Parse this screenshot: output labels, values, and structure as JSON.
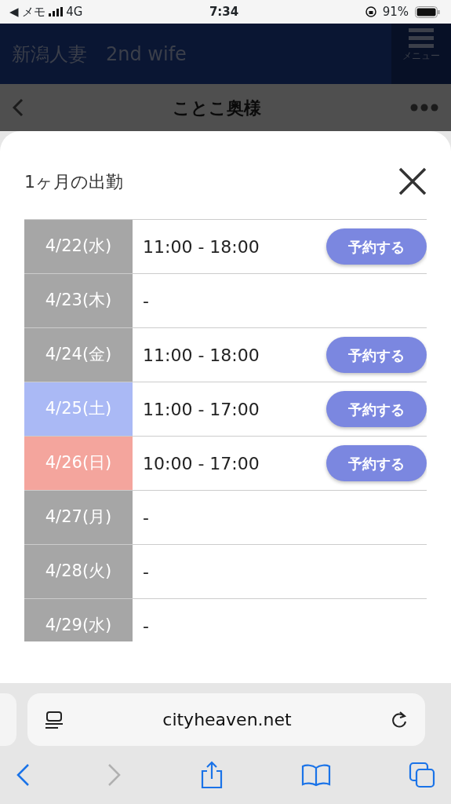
{
  "status_bar": {
    "back_app": "◀ メモ",
    "network": "4G",
    "time": "7:34",
    "battery": "91%"
  },
  "site_header": {
    "title": "新潟人妻　2nd wife",
    "menu_label": "メニュー"
  },
  "page_header": {
    "title": "ことこ奥様"
  },
  "modal": {
    "title": "1ヶ月の出勤",
    "rows": [
      {
        "date": "4/22(水)",
        "hours": "11:00 - 18:00",
        "button": "予約する",
        "color": "#a6a6a6"
      },
      {
        "date": "4/23(木)",
        "hours": "-",
        "color": "#a6a6a6"
      },
      {
        "date": "4/24(金)",
        "hours": "11:00 - 18:00",
        "button": "予約する",
        "color": "#a6a6a6"
      },
      {
        "date": "4/25(土)",
        "hours": "11:00 - 17:00",
        "button": "予約する",
        "color": "#aab9f5"
      },
      {
        "date": "4/26(日)",
        "hours": "10:00 - 17:00",
        "button": "予約する",
        "color": "#f4a59d"
      },
      {
        "date": "4/27(月)",
        "hours": "-",
        "color": "#a6a6a6"
      },
      {
        "date": "4/28(火)",
        "hours": "-",
        "color": "#a6a6a6"
      },
      {
        "date": "4/29(水)",
        "hours": "-",
        "color": "#a6a6a6"
      }
    ]
  },
  "browser": {
    "url": "cityheaven.net"
  }
}
